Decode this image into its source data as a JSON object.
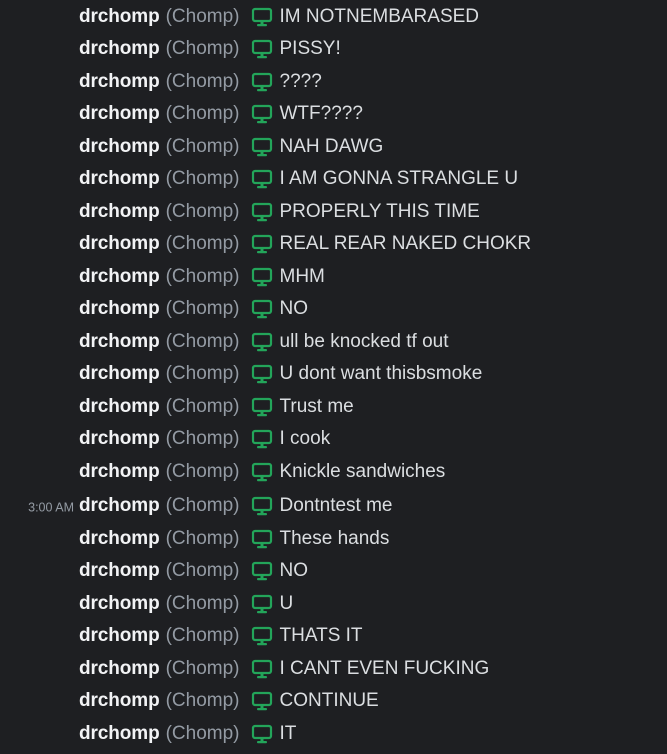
{
  "colors": {
    "background": "#1e1f22",
    "username": "#f2f3f5",
    "nickname": "#949ba4",
    "message_text": "#dbdee1",
    "timestamp": "#949ba4",
    "device_icon": "#23a55a"
  },
  "messages": [
    {
      "author": "drchomp",
      "nick": "(Chomp)",
      "icon": "desktop-icon",
      "text": "IM NOTNEMBARASED",
      "timestamp": ""
    },
    {
      "author": "drchomp",
      "nick": "(Chomp)",
      "icon": "desktop-icon",
      "text": "PISSY!",
      "timestamp": ""
    },
    {
      "author": "drchomp",
      "nick": "(Chomp)",
      "icon": "desktop-icon",
      "text": "????",
      "timestamp": ""
    },
    {
      "author": "drchomp",
      "nick": "(Chomp)",
      "icon": "desktop-icon",
      "text": "WTF????",
      "timestamp": ""
    },
    {
      "author": "drchomp",
      "nick": "(Chomp)",
      "icon": "desktop-icon",
      "text": "NAH DAWG",
      "timestamp": ""
    },
    {
      "author": "drchomp",
      "nick": "(Chomp)",
      "icon": "desktop-icon",
      "text": "I AM GONNA STRANGLE U",
      "timestamp": ""
    },
    {
      "author": "drchomp",
      "nick": "(Chomp)",
      "icon": "desktop-icon",
      "text": "PROPERLY THIS TIME",
      "timestamp": ""
    },
    {
      "author": "drchomp",
      "nick": "(Chomp)",
      "icon": "desktop-icon",
      "text": "REAL REAR NAKED CHOKR",
      "timestamp": ""
    },
    {
      "author": "drchomp",
      "nick": "(Chomp)",
      "icon": "desktop-icon",
      "text": "MHM",
      "timestamp": ""
    },
    {
      "author": "drchomp",
      "nick": "(Chomp)",
      "icon": "desktop-icon",
      "text": "NO",
      "timestamp": ""
    },
    {
      "author": "drchomp",
      "nick": "(Chomp)",
      "icon": "desktop-icon",
      "text": "ull be knocked tf out",
      "timestamp": ""
    },
    {
      "author": "drchomp",
      "nick": "(Chomp)",
      "icon": "desktop-icon",
      "text": "U dont want thisbsmoke",
      "timestamp": ""
    },
    {
      "author": "drchomp",
      "nick": "(Chomp)",
      "icon": "desktop-icon",
      "text": "Trust me",
      "timestamp": ""
    },
    {
      "author": "drchomp",
      "nick": "(Chomp)",
      "icon": "desktop-icon",
      "text": "I cook",
      "timestamp": ""
    },
    {
      "author": "drchomp",
      "nick": "(Chomp)",
      "icon": "desktop-icon",
      "text": "Knickle sandwiches",
      "timestamp": ""
    },
    {
      "author": "drchomp",
      "nick": "(Chomp)",
      "icon": "desktop-icon",
      "text": "Dontntest me",
      "timestamp": "3:00 AM"
    },
    {
      "author": "drchomp",
      "nick": "(Chomp)",
      "icon": "desktop-icon",
      "text": "These hands",
      "timestamp": ""
    },
    {
      "author": "drchomp",
      "nick": "(Chomp)",
      "icon": "desktop-icon",
      "text": "NO",
      "timestamp": ""
    },
    {
      "author": "drchomp",
      "nick": "(Chomp)",
      "icon": "desktop-icon",
      "text": "U",
      "timestamp": ""
    },
    {
      "author": "drchomp",
      "nick": "(Chomp)",
      "icon": "desktop-icon",
      "text": "THATS IT",
      "timestamp": ""
    },
    {
      "author": "drchomp",
      "nick": "(Chomp)",
      "icon": "desktop-icon",
      "text": "I CANT EVEN FUCKING",
      "timestamp": ""
    },
    {
      "author": "drchomp",
      "nick": "(Chomp)",
      "icon": "desktop-icon",
      "text": "CONTINUE",
      "timestamp": ""
    },
    {
      "author": "drchomp",
      "nick": "(Chomp)",
      "icon": "desktop-icon",
      "text": "IT",
      "timestamp": ""
    }
  ]
}
